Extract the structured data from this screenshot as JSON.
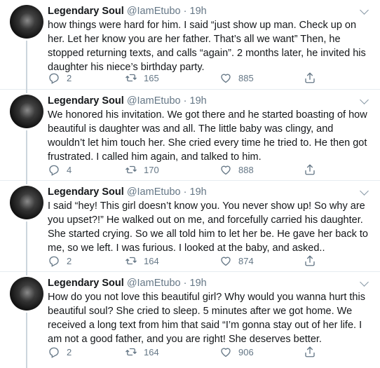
{
  "tweets": [
    {
      "author": "Legendary Soul",
      "handle": "@IamEtubo",
      "separator": "·",
      "time": "19h",
      "text": "how things were hard for him. I said “just show up man. Check up on her. Let her know you are her father. That’s all we want” Then, he stopped returning texts, and calls “again”. 2 months later, he invited his daughter his niece’s birthday party.",
      "replies": "2",
      "retweets": "165",
      "likes": "885"
    },
    {
      "author": "Legendary Soul",
      "handle": "@IamEtubo",
      "separator": "·",
      "time": "19h",
      "text": "We honored his invitation. We got there and he started boasting of how beautiful is daughter was and all. The little baby was clingy, and wouldn’t let him touch her. She cried every time he tried to. He then got frustrated. I called him again, and talked to him.",
      "replies": "4",
      "retweets": "170",
      "likes": "888"
    },
    {
      "author": "Legendary Soul",
      "handle": "@IamEtubo",
      "separator": "·",
      "time": "19h",
      "text": "I said “hey! This girl doesn’t know you. You never show up! So why are you upset?!” He walked out on me, and forcefully carried his daughter. She started crying. So we all told him to let her be. He gave her back to me, so we left. I was furious. I looked at the baby, and asked..",
      "replies": "2",
      "retweets": "164",
      "likes": "874"
    },
    {
      "author": "Legendary Soul",
      "handle": "@IamEtubo",
      "separator": "·",
      "time": "19h",
      "text": "How do you not love this beautiful girl? Why would you wanna hurt this beautiful soul? She cried to sleep. 5 minutes after we got home. We received a long text from him that said “I’m gonna stay out of her life. I am not a good father, and you are right! She deserves better.",
      "replies": "2",
      "retweets": "164",
      "likes": "906"
    }
  ],
  "icons": {
    "reply": "reply-icon",
    "retweet": "retweet-icon",
    "like": "heart-icon",
    "share": "share-icon",
    "menu": "chevron-down-icon"
  },
  "colors": {
    "text": "#14171a",
    "secondary": "#657786",
    "divider": "#e6ecf0",
    "thread_line": "#ccd6dd"
  }
}
